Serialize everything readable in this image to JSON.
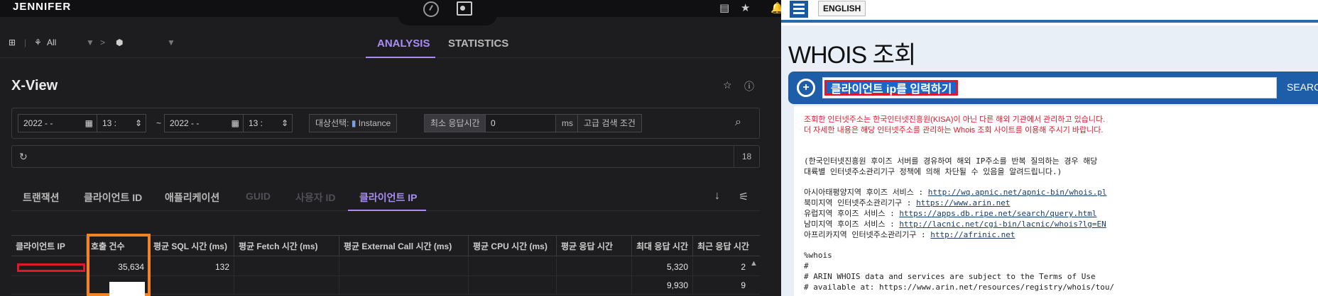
{
  "left": {
    "logo": "JENNIFER",
    "breadcrumb": {
      "scope": "All",
      "separator": ">"
    },
    "main_tabs": [
      {
        "label": "ANALYSIS",
        "active": true
      },
      {
        "label": "STATISTICS",
        "active": false
      }
    ],
    "page_title": "X-View",
    "search": {
      "date_from": "2022 -   -",
      "time_from": "13 :",
      "range_sep": "~",
      "date_to": "2022 -   -",
      "time_to": "13 :",
      "target_label": "대상선택:",
      "target_value": "Instance",
      "min_response_label": "최소 응답시간",
      "min_response_value": "0",
      "min_response_unit": "ms",
      "advanced_label": "고급 검색 조건"
    },
    "refresh_count": "18",
    "sub_tabs": [
      {
        "label": "트랜잭션",
        "state": "on"
      },
      {
        "label": "클라이언트 ID",
        "state": "on"
      },
      {
        "label": "애플리케이션",
        "state": "on"
      },
      {
        "label": "GUID",
        "state": "dim"
      },
      {
        "label": "사용자 ID",
        "state": "dim"
      },
      {
        "label": "클라이언트 IP",
        "state": "active"
      }
    ],
    "table": {
      "columns": [
        "클라이언트 IP",
        "호출 건수",
        "평균 SQL 시간 (ms)",
        "평균 Fetch 시간 (ms)",
        "평균 External Call 시간 (ms)",
        "평균 CPU 시간 (ms)",
        "평균 응답 시간",
        "최대 응답 시간",
        "최근 응답 시간"
      ],
      "rows": [
        [
          "",
          "35,634",
          "132",
          "",
          "",
          "",
          "",
          "5,320",
          "2"
        ],
        [
          "",
          "",
          "",
          "",
          "",
          "",
          "",
          "9,930",
          "9"
        ]
      ]
    }
  },
  "right": {
    "lang_button": "ENGLISH",
    "title": "WHOIS 조회",
    "search_value": "클라이언트 ip를 입력하기",
    "search_button": "SEARCH",
    "notice_lines": [
      "조회한 인터넷주소는 한국인터넷진흥원(KISA)이 아닌 다른 해외 기관에서 관리하고 있습니다.",
      "더 자세한 내용은 해당 인터넷주소를 관리하는 Whois 조회 사이트를 이용해 주시기 바랍니다."
    ],
    "info_lines": [
      "(한국인터넷진흥원 후이즈 서버를 경유하여 해외 IP주소를 반복 질의하는 경우 해당",
      "대륙별 인터넷주소관리기구 정책에 의해 차단될 수 있음을 알려드립니다.)"
    ],
    "registries": [
      {
        "label": "아시아태평양지역 후이즈 서비스 : ",
        "url": "http://wq.apnic.net/apnic-bin/whois.pl"
      },
      {
        "label": "북미지역 인터넷주소관리기구 : ",
        "url": "https://www.arin.net"
      },
      {
        "label": "유럽지역 후이즈 서비스 : ",
        "url": "https://apps.db.ripe.net/search/query.html"
      },
      {
        "label": "남미지역 후이즈 서비스 : ",
        "url": "http://lacnic.net/cgi-bin/lacnic/whois?lg=EN"
      },
      {
        "label": "아프리카지역 인터넷주소관리기구 : ",
        "url": "http://afrinic.net"
      }
    ],
    "raw_lines": [
      "%whois",
      "#",
      "# ARIN WHOIS data and services are subject to the Terms of Use",
      "# available at: https://www.arin.net/resources/registry/whois/tou/"
    ]
  }
}
